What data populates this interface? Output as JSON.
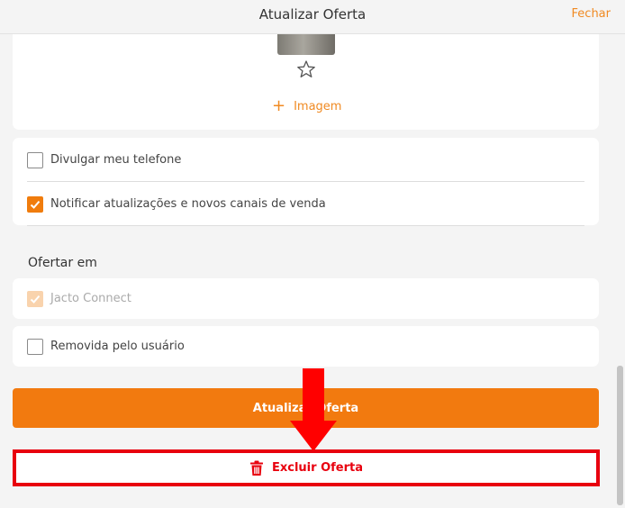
{
  "header": {
    "title": "Atualizar Oferta",
    "close_label": "Fechar"
  },
  "image_section": {
    "favorite_icon": "star-outline-icon",
    "add_image_label": "Imagem",
    "add_icon": "plus-icon"
  },
  "options": [
    {
      "label": "Divulgar meu telefone",
      "checked": false
    },
    {
      "label": "Notificar atualizações e novos canais de venda",
      "checked": true
    }
  ],
  "offer_in": {
    "title": "Ofertar em",
    "channels": [
      {
        "label": "Jacto Connect",
        "checked": true,
        "disabled": true
      },
      {
        "label": "Removida pelo usuário",
        "checked": false,
        "disabled": false
      }
    ]
  },
  "actions": {
    "update_label": "Atualizar Oferta",
    "delete_label": "Excluir Oferta",
    "delete_icon": "trash-icon"
  },
  "colors": {
    "accent": "#f27a0f",
    "danger": "#e8000e",
    "background": "#f4f4f4"
  }
}
